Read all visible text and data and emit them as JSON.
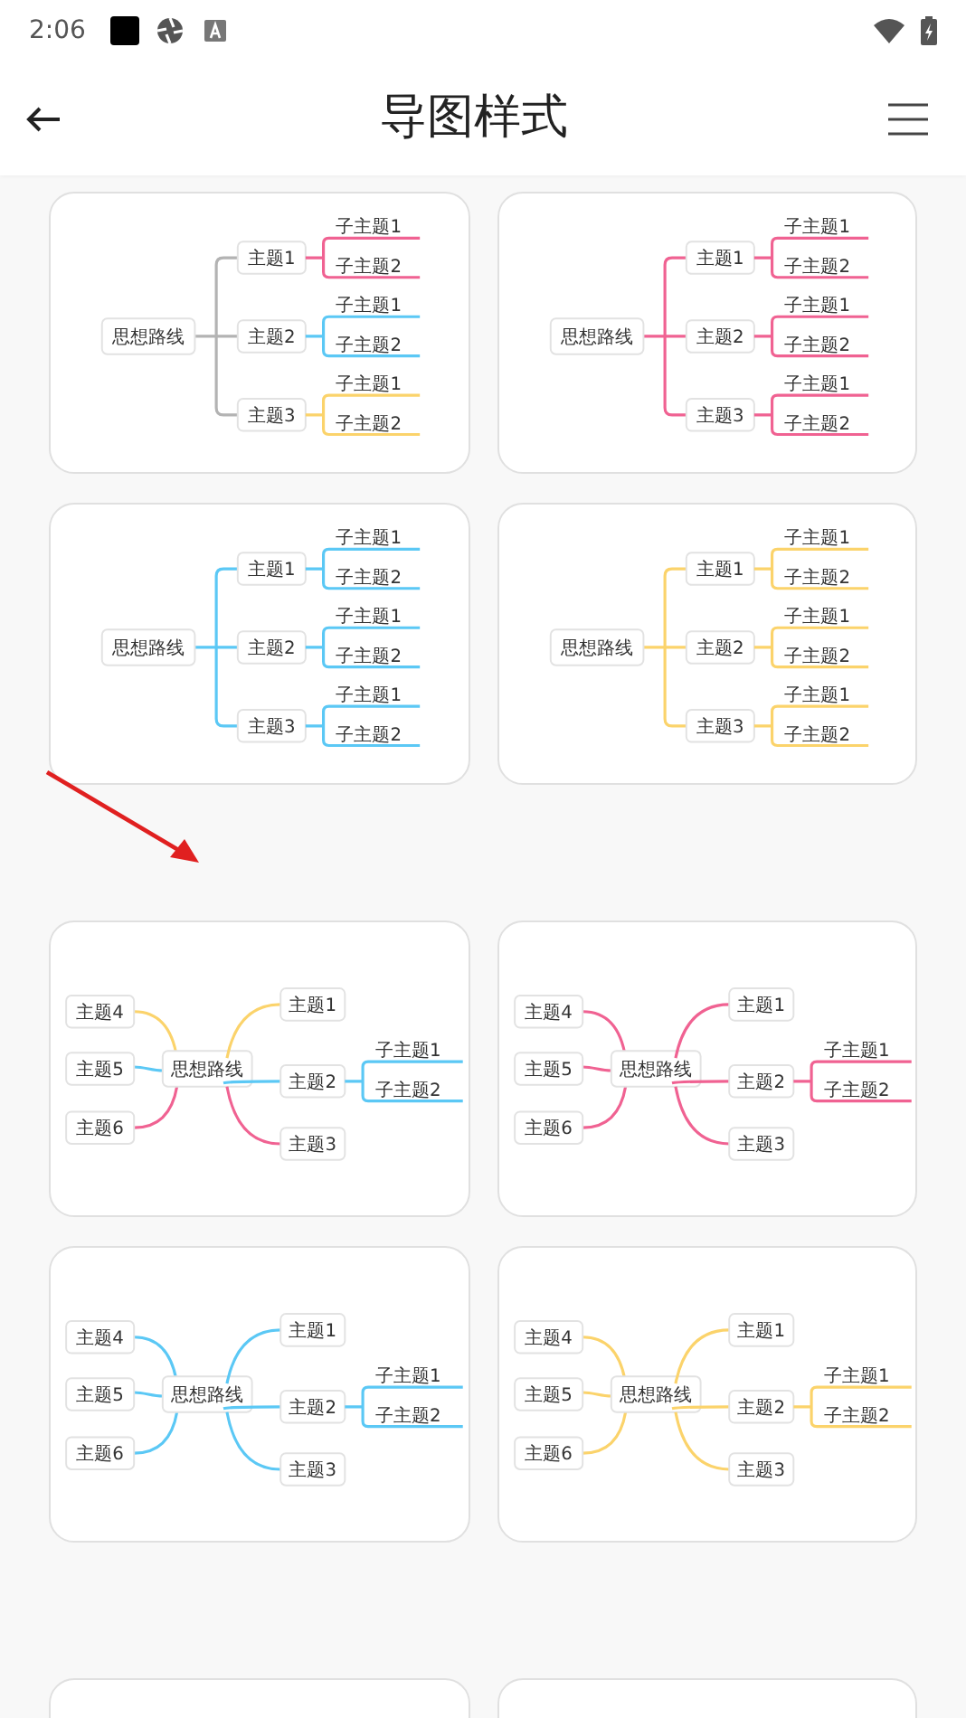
{
  "status_bar": {
    "time": "2:06"
  },
  "header": {
    "title": "导图样式"
  },
  "cards": [
    {
      "kind": "tree",
      "color": "#b3b3b3",
      "center": "思想路线",
      "topics": [
        {
          "label": "主题1",
          "color": "#f06292",
          "children": [
            "子主题1",
            "子主题2"
          ]
        },
        {
          "label": "主题2",
          "color": "#5bc8f5",
          "children": [
            "子主题1",
            "子主题2"
          ]
        },
        {
          "label": "主题3",
          "color": "#fbd36b",
          "children": [
            "子主题1",
            "子主题2"
          ]
        }
      ]
    },
    {
      "kind": "tree",
      "color": "#f06292",
      "center": "思想路线",
      "topics": [
        {
          "label": "主题1",
          "color": "#f06292",
          "children": [
            "子主题1",
            "子主题2"
          ]
        },
        {
          "label": "主题2",
          "color": "#f06292",
          "children": [
            "子主题1",
            "子主题2"
          ]
        },
        {
          "label": "主题3",
          "color": "#f06292",
          "children": [
            "子主题1",
            "子主题2"
          ]
        }
      ]
    },
    {
      "kind": "tree",
      "color": "#5bc8f5",
      "center": "思想路线",
      "topics": [
        {
          "label": "主题1",
          "color": "#5bc8f5",
          "children": [
            "子主题1",
            "子主题2"
          ]
        },
        {
          "label": "主题2",
          "color": "#5bc8f5",
          "children": [
            "子主题1",
            "子主题2"
          ]
        },
        {
          "label": "主题3",
          "color": "#5bc8f5",
          "children": [
            "子主题1",
            "子主题2"
          ]
        }
      ]
    },
    {
      "kind": "tree",
      "color": "#fbd36b",
      "center": "思想路线",
      "topics": [
        {
          "label": "主题1",
          "color": "#fbd36b",
          "children": [
            "子主题1",
            "子主题2"
          ]
        },
        {
          "label": "主题2",
          "color": "#fbd36b",
          "children": [
            "子主题1",
            "子主题2"
          ]
        },
        {
          "label": "主题3",
          "color": "#fbd36b",
          "children": [
            "子主题1",
            "子主题2"
          ]
        }
      ]
    },
    {
      "kind": "radial",
      "left_topics": [
        {
          "label": "主题4",
          "color": "#fbd36b"
        },
        {
          "label": "主题5",
          "color": "#5bc8f5"
        },
        {
          "label": "主题6",
          "color": "#f06292"
        }
      ],
      "center": "思想路线",
      "right_topics": [
        {
          "label": "主题1",
          "color": "#fbd36b"
        },
        {
          "label": "主题2",
          "color": "#5bc8f5",
          "children": [
            "子主题1",
            "子主题2"
          ]
        },
        {
          "label": "主题3",
          "color": "#f06292"
        }
      ]
    },
    {
      "kind": "radial",
      "left_topics": [
        {
          "label": "主题4",
          "color": "#f06292"
        },
        {
          "label": "主题5",
          "color": "#f06292"
        },
        {
          "label": "主题6",
          "color": "#f06292"
        }
      ],
      "center": "思想路线",
      "right_topics": [
        {
          "label": "主题1",
          "color": "#f06292"
        },
        {
          "label": "主题2",
          "color": "#f06292",
          "children": [
            "子主题1",
            "子主题2"
          ]
        },
        {
          "label": "主题3",
          "color": "#f06292"
        }
      ]
    },
    {
      "kind": "radial",
      "left_topics": [
        {
          "label": "主题4",
          "color": "#5bc8f5"
        },
        {
          "label": "主题5",
          "color": "#5bc8f5"
        },
        {
          "label": "主题6",
          "color": "#5bc8f5"
        }
      ],
      "center": "思想路线",
      "right_topics": [
        {
          "label": "主题1",
          "color": "#5bc8f5"
        },
        {
          "label": "主题2",
          "color": "#5bc8f5",
          "children": [
            "子主题1",
            "子主题2"
          ]
        },
        {
          "label": "主题3",
          "color": "#5bc8f5"
        }
      ]
    },
    {
      "kind": "radial",
      "left_topics": [
        {
          "label": "主题4",
          "color": "#fbd36b"
        },
        {
          "label": "主题5",
          "color": "#fbd36b"
        },
        {
          "label": "主题6",
          "color": "#fbd36b"
        }
      ],
      "center": "思想路线",
      "right_topics": [
        {
          "label": "主题1",
          "color": "#fbd36b"
        },
        {
          "label": "主题2",
          "color": "#fbd36b",
          "children": [
            "子主题1",
            "子主题2"
          ]
        },
        {
          "label": "主题3",
          "color": "#fbd36b"
        }
      ]
    },
    {
      "kind": "blank"
    },
    {
      "kind": "blank"
    }
  ]
}
